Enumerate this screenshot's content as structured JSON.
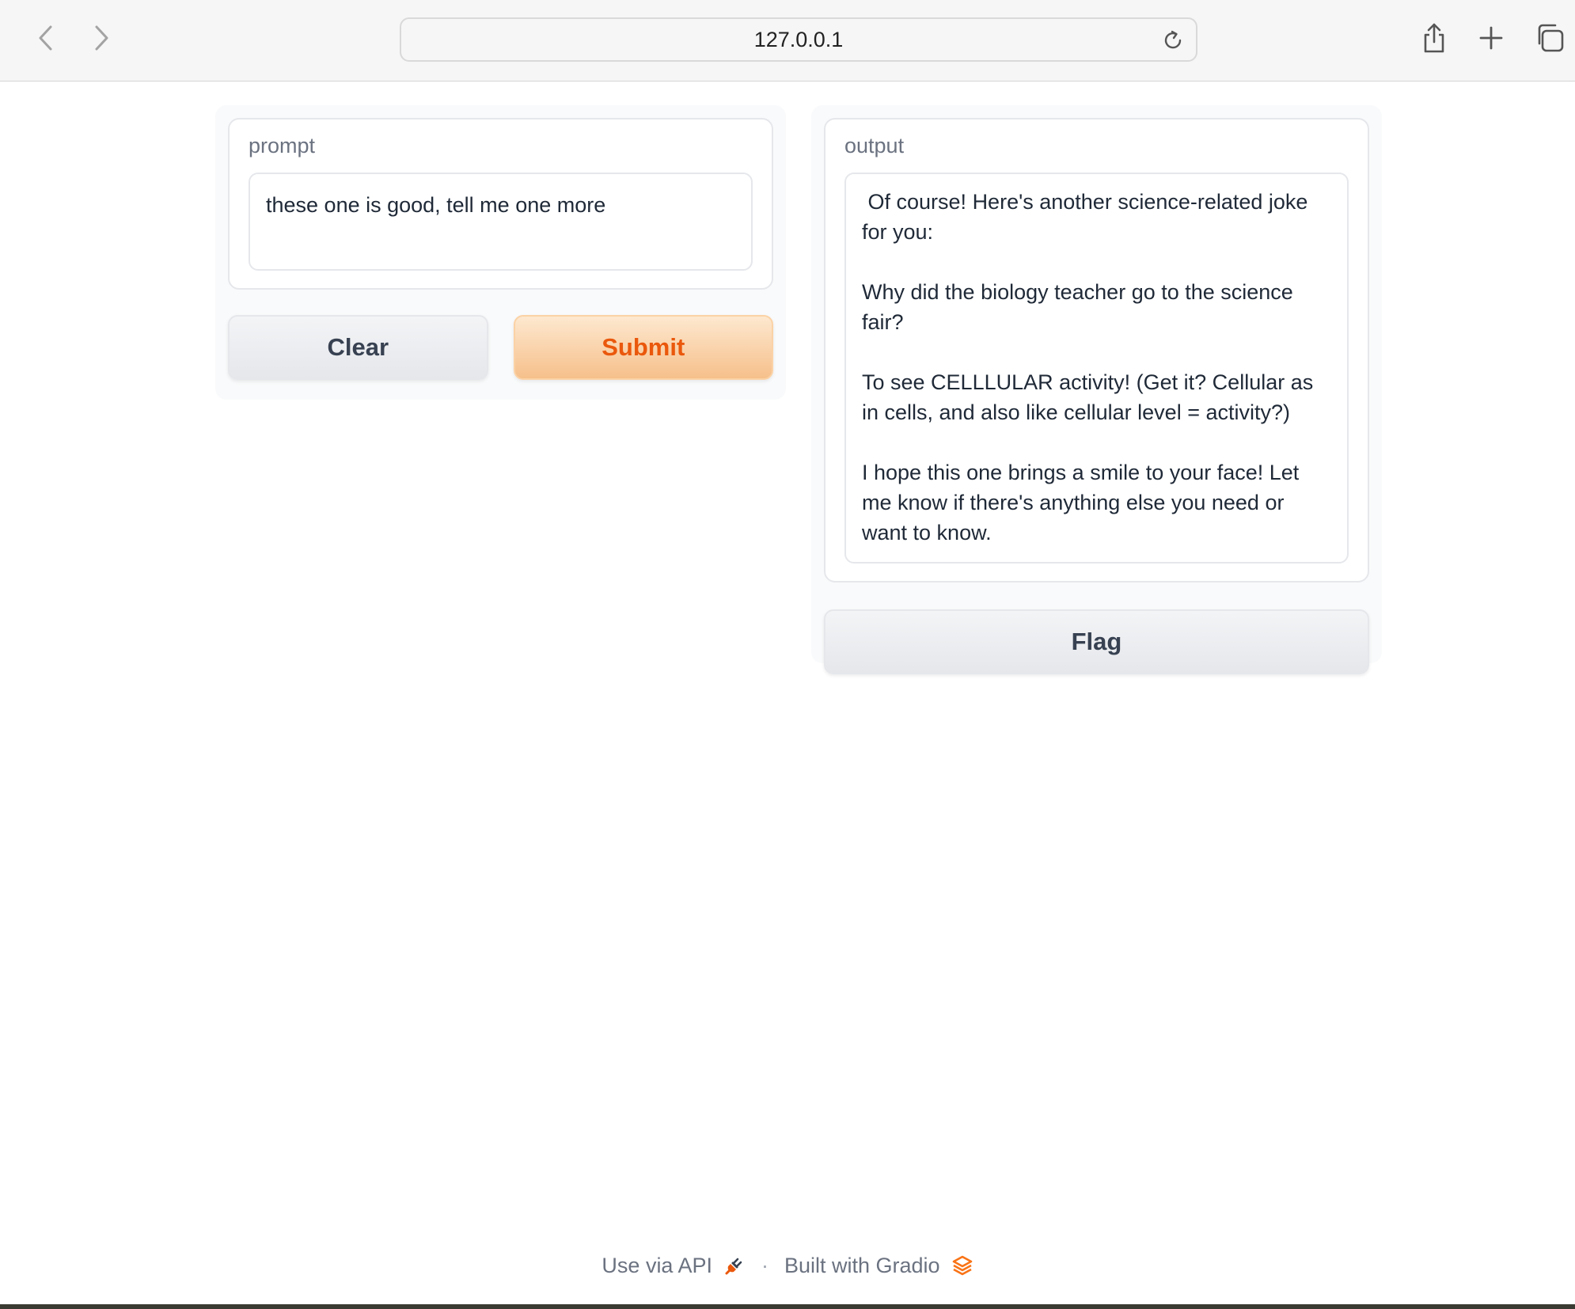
{
  "browser": {
    "url": "127.0.0.1",
    "icons": {
      "back": "chevron-left-icon",
      "forward": "chevron-right-icon",
      "reload": "reload-icon",
      "share": "share-icon",
      "new_tab": "plus-icon",
      "tabs": "tabs-overview-icon"
    }
  },
  "input": {
    "label": "prompt",
    "value": "these one is good, tell me one more"
  },
  "buttons": {
    "clear": "Clear",
    "submit": "Submit",
    "flag": "Flag"
  },
  "output": {
    "label": "output",
    "value": " Of course! Here's another science-related joke for you:\n\nWhy did the biology teacher go to the science fair?\n\nTo see CELLLULAR activity! (Get it? Cellular as in cells, and also like cellular level = activity?)\n\nI hope this one brings a smile to your face! Let me know if there's anything else you need or want to know."
  },
  "footer": {
    "api_link": "Use via API",
    "separator": "·",
    "built_with": "Built with Gradio"
  },
  "colors": {
    "accent": "#ea580c",
    "primary_button_top": "#fde8cf",
    "primary_button_bottom": "#f6c08b"
  }
}
